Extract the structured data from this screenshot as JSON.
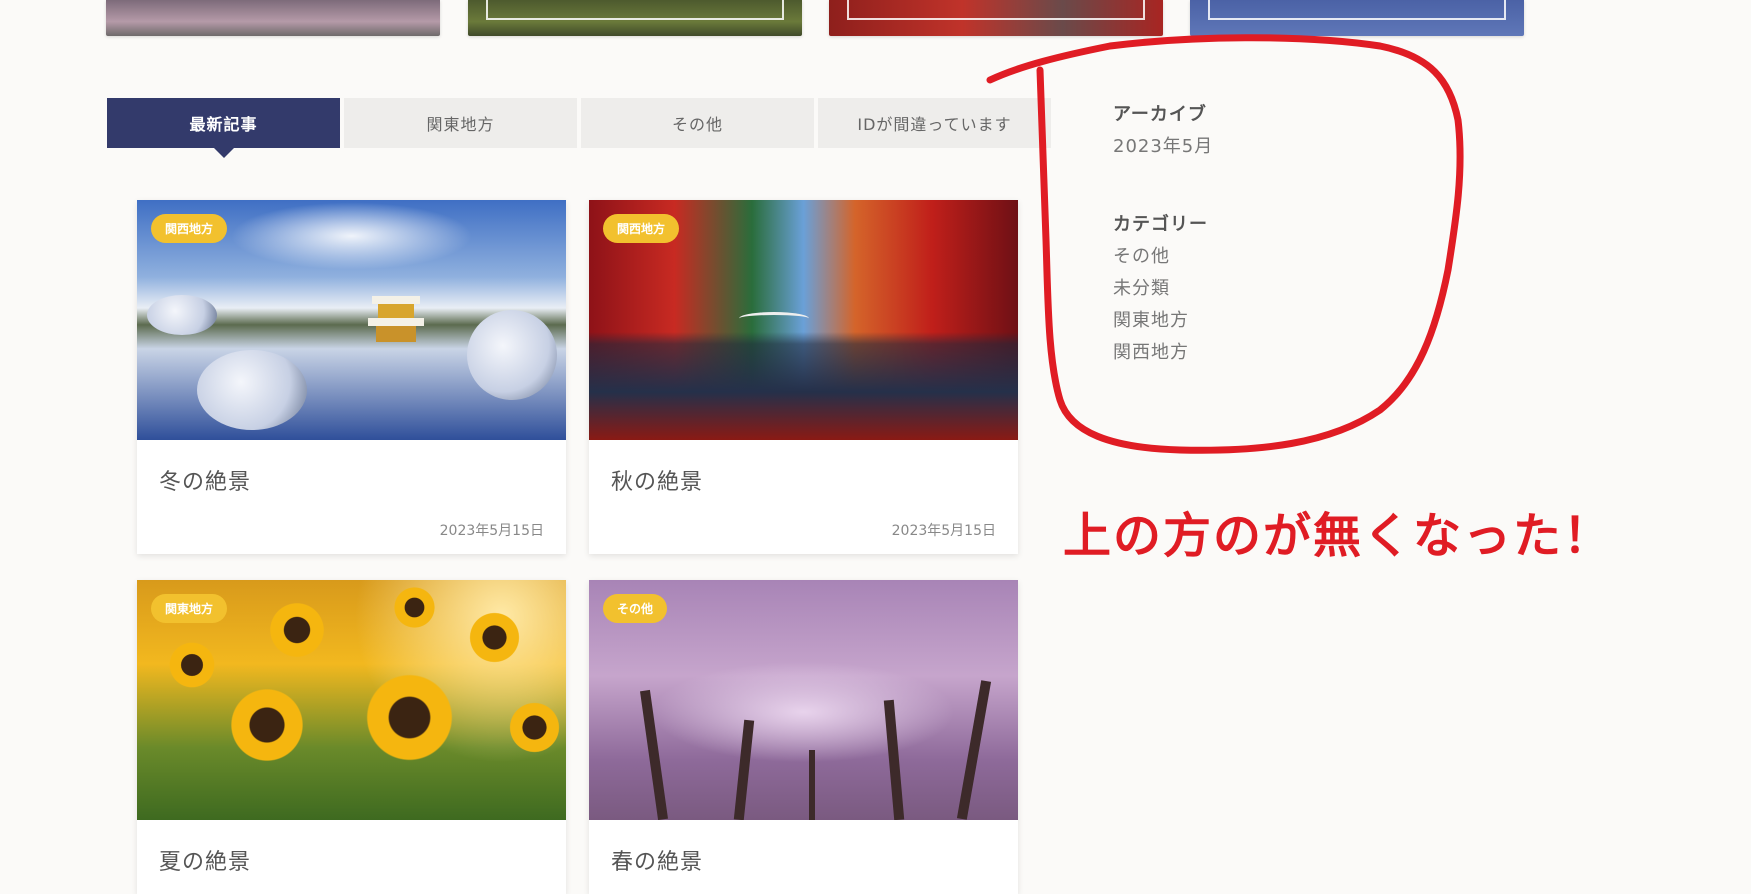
{
  "tabs": [
    {
      "label": "最新記事",
      "active": true
    },
    {
      "label": "関東地方",
      "active": false
    },
    {
      "label": "その他",
      "active": false
    },
    {
      "label": "IDが間違っています",
      "active": false
    }
  ],
  "cards": [
    {
      "title": "冬の絶景",
      "date": "2023年5月15日",
      "badge": "関西地方"
    },
    {
      "title": "秋の絶景",
      "date": "2023年5月15日",
      "badge": "関西地方"
    },
    {
      "title": "夏の絶景",
      "date": "",
      "badge": "関東地方"
    },
    {
      "title": "春の絶景",
      "date": "",
      "badge": "その他"
    }
  ],
  "sidebar": {
    "archive": {
      "heading": "アーカイブ",
      "items": [
        "2023年5月"
      ]
    },
    "category": {
      "heading": "カテゴリー",
      "items": [
        "その他",
        "未分類",
        "関東地方",
        "関西地方"
      ]
    }
  },
  "annotation": {
    "text": "上の方のが無くなった！",
    "color": "#e01c24"
  },
  "colors": {
    "accent": "#333a6b",
    "badge": "#f2c12e",
    "background": "#fbfaf8"
  }
}
